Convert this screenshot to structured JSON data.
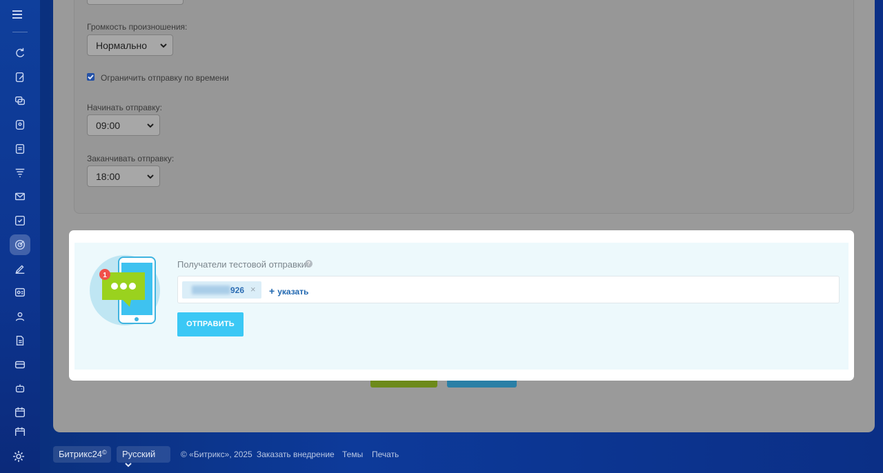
{
  "form": {
    "volume_label": "Громкость произношения:",
    "volume_value": "Нормально",
    "limit_label": "Ограничить отправку по времени",
    "start_label": "Начинать отправку:",
    "start_value": "09:00",
    "end_label": "Заканчивать отправку:",
    "end_value": "18:00"
  },
  "test_send": {
    "recipients_label": "Получатели тестовой отправки",
    "help_glyph": "?",
    "badge_count": "1",
    "recipient_suffix": "926",
    "remove_glyph": "×",
    "add_label": "указать",
    "send_label": "ОТПРАВИТЬ"
  },
  "footer": {
    "brand": "Битрикс24",
    "language": "Русский",
    "copyright": "© «Битрикс», 2025",
    "order_link": "Заказать внедрение",
    "themes_link": "Темы",
    "print_link": "Печать"
  },
  "sidebar": {
    "icons": [
      "refresh-icon",
      "edit-doc-icon",
      "chat-icon",
      "contact-icon",
      "document-icon",
      "funnel-icon",
      "mail-icon",
      "checkbox-icon",
      "target-icon",
      "pen-icon",
      "id-card-icon",
      "users-icon",
      "file-icon",
      "card-icon",
      "robot-icon",
      "calendar-icon",
      "calendar-icon"
    ],
    "active_icon": "target-icon"
  },
  "colors": {
    "accent": "#3bc8f5",
    "sidebar": "#0f3f9c",
    "link": "#2067b0"
  }
}
